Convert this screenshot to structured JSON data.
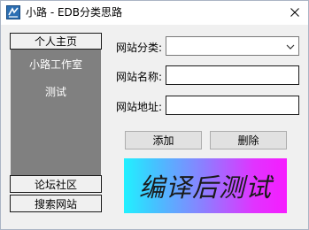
{
  "window": {
    "title": "小路 - EDB分类思路"
  },
  "nav": {
    "top_label": "个人主页",
    "panel_items": [
      "小路工作室",
      "测试"
    ],
    "forum_label": "论坛社区",
    "search_label": "搜索网站"
  },
  "form": {
    "category_label": "网站分类:",
    "category_value": "",
    "name_label": "网站名称:",
    "name_value": "",
    "url_label": "网站地址:",
    "url_value": "",
    "add_label": "添加",
    "delete_label": "删除"
  },
  "banner": {
    "text": "编译后测试"
  },
  "icons": {
    "app": "app-icon",
    "close": "close-icon",
    "dropdown": "chevron-down-icon"
  }
}
